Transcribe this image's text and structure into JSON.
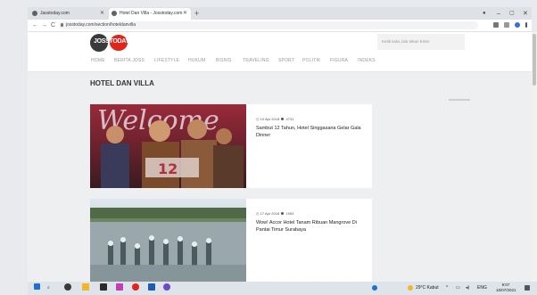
{
  "browser": {
    "tabs": [
      {
        "label": "Jasstoday.com",
        "active": false
      },
      {
        "label": "Hotel Dan Villa - Josstoday.com",
        "active": true
      }
    ],
    "new_tab": "+",
    "window_controls": {
      "minimize": "–",
      "maximize": "▢",
      "close": "✕"
    },
    "url": "josstoday.com/section/hoteldanvilla",
    "nav": {
      "back": "←",
      "forward": "→",
      "reload": "C"
    }
  },
  "site": {
    "logo_text": "JOSSTODAY",
    "search_placeholder": "Ketik kata, lalu tekan Enter",
    "nav_items": [
      "HOME",
      "BERITA JOSS",
      "LIFESTYLE",
      "HUKUM",
      "BISNIS",
      "TRAVELING",
      "SPORT",
      "POLITIK",
      "FIGURA",
      "INDEKS"
    ],
    "section_title": "HOTEL DAN VILLA",
    "articles": [
      {
        "date": "10 Apr 2018",
        "views": "4731",
        "title": "Sambut 12 Tahun, Hotel Singgasana Gelar Gala Dinner"
      },
      {
        "date": "17 Apr 2018",
        "views": "1953",
        "title": "Wow! Accor Hotel Tanam Ribuan Mangrove Di Pantai Timur Surabaya"
      }
    ]
  },
  "taskbar": {
    "weather": "29°C  Kabut",
    "lang": "ENG",
    "time": "9:07",
    "date": "16/07/2021"
  },
  "colors": {
    "brand_red": "#e1251b",
    "page_bg": "#eeeff1"
  }
}
